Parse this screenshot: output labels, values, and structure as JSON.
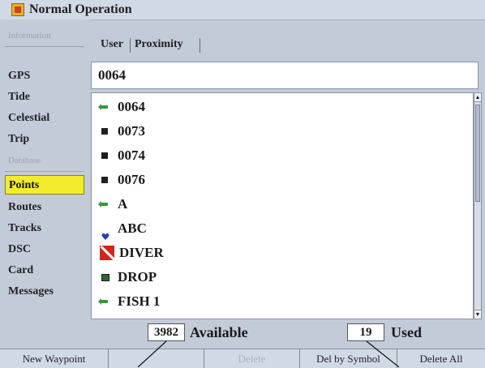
{
  "title": "Normal Operation",
  "sidebar": {
    "items": [
      {
        "label": "Information",
        "disabled": true
      },
      {
        "label": "GPS",
        "disabled": false
      },
      {
        "label": "Tide",
        "disabled": false
      },
      {
        "label": "Celestial",
        "disabled": false
      },
      {
        "label": "Trip",
        "disabled": false
      },
      {
        "label": "Database",
        "disabled": true
      },
      {
        "label": "Points",
        "disabled": false,
        "selected": true
      },
      {
        "label": "Routes",
        "disabled": false
      },
      {
        "label": "Tracks",
        "disabled": false
      },
      {
        "label": "DSC",
        "disabled": false
      },
      {
        "label": "Card",
        "disabled": false
      },
      {
        "label": "Messages",
        "disabled": false
      }
    ]
  },
  "tabs": [
    {
      "label": "User",
      "selected": true
    },
    {
      "label": "Proximity",
      "selected": false
    }
  ],
  "search": {
    "value": "0064"
  },
  "waypoints": [
    {
      "name": "0064",
      "icon": "green-flag-icon"
    },
    {
      "name": "0073",
      "icon": "black-square-icon"
    },
    {
      "name": "0074",
      "icon": "black-square-icon"
    },
    {
      "name": "0076",
      "icon": "black-square-icon"
    },
    {
      "name": "A",
      "icon": "green-flag-icon"
    },
    {
      "name": "ABC",
      "icon": "blue-heart-icon"
    },
    {
      "name": "DIVER",
      "icon": "diver-down-flag-icon"
    },
    {
      "name": "DROP",
      "icon": "green-square-icon"
    },
    {
      "name": "FISH 1",
      "icon": "green-flag-icon"
    }
  ],
  "status": {
    "available_count": "3982",
    "available_label": "Available",
    "used_count": "19",
    "used_label": "Used"
  },
  "softkeys": [
    {
      "label": "New Waypoint",
      "disabled": false
    },
    {
      "label": "",
      "disabled": true
    },
    {
      "label": "Delete",
      "disabled": true
    },
    {
      "label": "Del by Symbol",
      "disabled": false
    },
    {
      "label": "Delete All",
      "disabled": false
    }
  ],
  "colors": {
    "selected_highlight": "#f2ec2c",
    "background": "#c3cbd9",
    "flag_green": "#2e9a3a",
    "heart_blue": "#1f3fb0",
    "diver_red": "#d2261c"
  }
}
